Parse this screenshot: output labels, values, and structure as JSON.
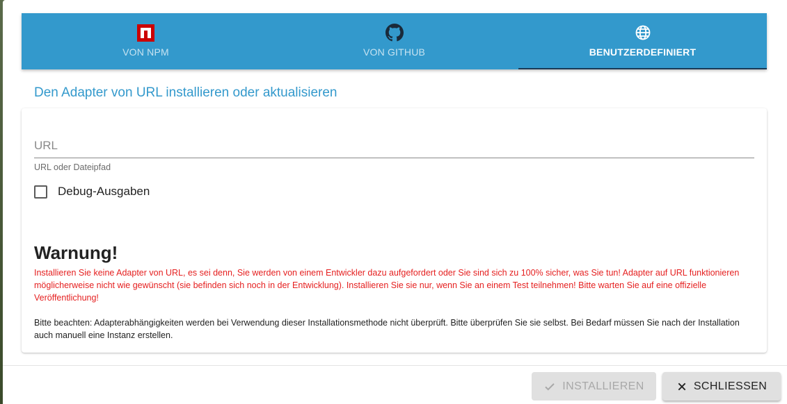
{
  "tabs": [
    {
      "label": "VON NPM",
      "icon": "npm-icon",
      "active": false
    },
    {
      "label": "VON GITHUB",
      "icon": "github-icon",
      "active": false
    },
    {
      "label": "BENUTZERDEFINIERT",
      "icon": "globe-icon",
      "active": true
    }
  ],
  "heading": "Den Adapter von URL installieren oder aktualisieren",
  "url_field": {
    "placeholder": "URL",
    "value": "",
    "helper": "URL oder Dateipfad"
  },
  "debug_checkbox": {
    "label": "Debug-Ausgaben",
    "checked": false
  },
  "warning": {
    "title": "Warnung!",
    "text": "Installieren Sie keine Adapter von URL, es sei denn, Sie werden von einem Entwickler dazu aufgefordert oder Sie sind sich zu 100% sicher, was Sie tun! Adapter auf URL funktionieren möglicherweise nicht wie gewünscht (sie befinden sich noch in der Entwicklung). Installieren Sie sie nur, wenn Sie an einem Test teilnehmen! Bitte warten Sie auf eine offizielle Veröffentlichung!",
    "color": "#e52020"
  },
  "note": "Bitte beachten: Adapterabhängigkeiten werden bei Verwendung dieser Installationsmethode nicht überprüft. Bitte überprüfen Sie sie selbst. Bei Bedarf müssen Sie nach der Installation auch manuell eine Instanz erstellen.",
  "buttons": {
    "install": {
      "label": "INSTALLIEREN",
      "icon": "check-icon",
      "disabled": true
    },
    "close": {
      "label": "SCHLIESSEN",
      "icon": "close-icon"
    }
  },
  "colors": {
    "accent": "#3399cc",
    "warning": "#e52020",
    "npm_red": "#cb0000"
  }
}
